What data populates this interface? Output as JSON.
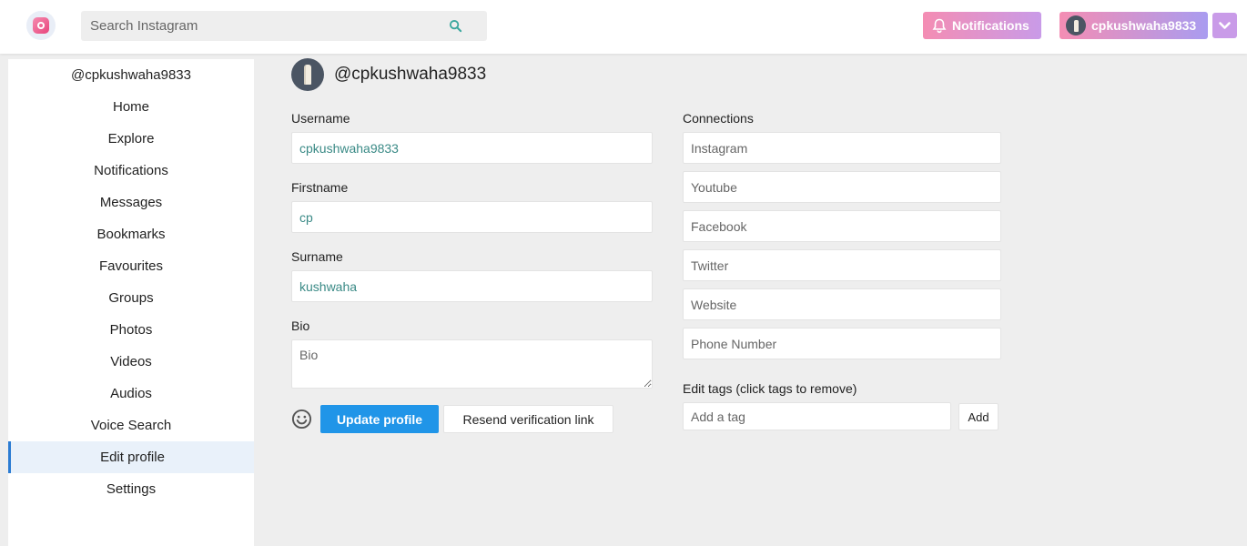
{
  "header": {
    "search_placeholder": "Search Instagram",
    "notifications_label": "Notifications",
    "user_label": "cpkushwaha9833"
  },
  "sidebar": {
    "handle": "@cpkushwaha9833",
    "items": [
      {
        "label": "Home"
      },
      {
        "label": "Explore"
      },
      {
        "label": "Notifications"
      },
      {
        "label": "Messages"
      },
      {
        "label": "Bookmarks"
      },
      {
        "label": "Favourites"
      },
      {
        "label": "Groups"
      },
      {
        "label": "Photos"
      },
      {
        "label": "Videos"
      },
      {
        "label": "Audios"
      },
      {
        "label": "Voice Search"
      },
      {
        "label": "Edit profile"
      },
      {
        "label": "Settings"
      }
    ],
    "active": "Edit profile"
  },
  "profile": {
    "handle": "@cpkushwaha9833"
  },
  "form": {
    "username_label": "Username",
    "username_value": "cpkushwaha9833",
    "firstname_label": "Firstname",
    "firstname_value": "cp",
    "surname_label": "Surname",
    "surname_value": "kushwaha",
    "bio_label": "Bio",
    "bio_placeholder": "Bio",
    "update_button": "Update profile",
    "resend_button": "Resend verification link"
  },
  "connections": {
    "label": "Connections",
    "instagram_placeholder": "Instagram",
    "youtube_placeholder": "Youtube",
    "facebook_placeholder": "Facebook",
    "twitter_placeholder": "Twitter",
    "website_placeholder": "Website",
    "phone_placeholder": "Phone Number"
  },
  "tags": {
    "label": "Edit tags (click tags to remove)",
    "placeholder": "Add a tag",
    "add_button": "Add"
  },
  "colors": {
    "primary_button": "#2095e8",
    "field_value": "#3a8a86",
    "gradient_pink": "#f48db3",
    "gradient_purple": "#c99be8"
  }
}
